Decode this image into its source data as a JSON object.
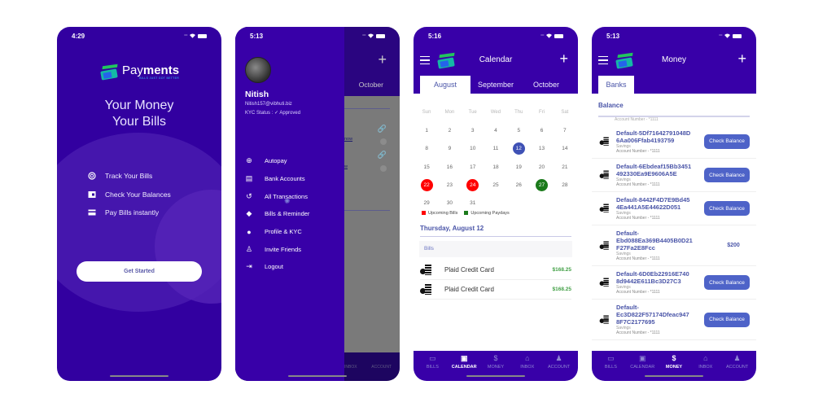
{
  "colors": {
    "brand": "#3800a8",
    "accent": "#4e63c8",
    "bills": "#ff0000",
    "paydays": "#1b7a1b",
    "selected": "#3f51b5",
    "amount": "#43a047"
  },
  "screen1": {
    "time": "4:29",
    "logo": {
      "word_light": "Pay",
      "word_bold": "ments",
      "tagline": "BILLS JUST GOT BETTER"
    },
    "hero": [
      "Your Money",
      "Your Bills"
    ],
    "features": [
      {
        "icon": "track-icon",
        "label": "Track Your Bills"
      },
      {
        "icon": "wallet-icon",
        "label": "Check Your Balances"
      },
      {
        "icon": "card-icon",
        "label": "Pay Bills instantly"
      }
    ],
    "cta": "Get Started"
  },
  "screen2": {
    "time": "5:13",
    "user": {
      "name": "Nitish",
      "email": "Nitish157@vibhuti.biz",
      "kyc": "KYC Status : ✓ Approved"
    },
    "menu": [
      {
        "icon": "add-circle-icon",
        "label": "Autopay"
      },
      {
        "icon": "bank-icon",
        "label": "Bank Accounts"
      },
      {
        "icon": "history-icon",
        "label": "All Transactions"
      },
      {
        "icon": "tag-icon",
        "label": "Bills & Reminder"
      },
      {
        "icon": "person-icon",
        "label": "Profile & KYC"
      },
      {
        "icon": "invite-icon",
        "label": "Invite Friends"
      },
      {
        "icon": "logout-icon",
        "label": "Logout"
      }
    ],
    "background": {
      "tab": "October",
      "link1": "now",
      "link2": "w",
      "tabbar": [
        "INBOX",
        "ACCOUNT"
      ]
    }
  },
  "screen3": {
    "time": "5:16",
    "title": "Calendar",
    "tabs": [
      "August",
      "September",
      "October"
    ],
    "active_tab": "August",
    "weekdays": [
      "Sun",
      "Mon",
      "Tue",
      "Wed",
      "Thu",
      "Fri",
      "Sat"
    ],
    "weeks": [
      [
        "1",
        "2",
        "3",
        "4",
        "5",
        "6",
        "7"
      ],
      [
        "8",
        "9",
        "10",
        "11",
        "12",
        "13",
        "14"
      ],
      [
        "15",
        "16",
        "17",
        "18",
        "19",
        "20",
        "21"
      ],
      [
        "22",
        "23",
        "24",
        "25",
        "26",
        "27",
        "28"
      ],
      [
        "29",
        "30",
        "31",
        "",
        "",
        "",
        ""
      ]
    ],
    "marked": {
      "12": "selected",
      "22": "bill",
      "24": "bill",
      "27": "payday"
    },
    "legend": [
      "Upcoming Bills",
      "Upcoming Paydays"
    ],
    "date_heading": "Thursday, August 12",
    "section": "Bills",
    "bills": [
      {
        "name": "Plaid Credit Card",
        "amount": "$168.25"
      },
      {
        "name": "Plaid Credit Card",
        "amount": "$168.25"
      }
    ]
  },
  "screen4": {
    "time": "5:13",
    "title": "Money",
    "tabs": [
      "Banks"
    ],
    "balance_label": "Balance",
    "ghost_text": "Account Number - *1111",
    "accounts": [
      {
        "name": [
          "Default-5Df71642791048D",
          "6Aa006Ffab4193759"
        ],
        "type": "Savings",
        "number": "Account Number - *1111",
        "action": "Check Balance"
      },
      {
        "name": [
          "Default-6Ebdeaf15Bb3451",
          "492330Ea9E9606A5E"
        ],
        "type": "Savings",
        "number": "Account Number - *1111",
        "action": "Check Balance"
      },
      {
        "name": [
          "Default-8442F4D7E9Bd45",
          "4Ea441A5E44622D051"
        ],
        "type": "Savings",
        "number": "Account Number - *1111",
        "action": "Check Balance"
      },
      {
        "name": [
          "Default-",
          "Ebd088Ea369B4405B0D21",
          "F27Fa2E8Fcc"
        ],
        "type": "Savings",
        "number": "Account Number - *1111",
        "balance": "$200"
      },
      {
        "name": [
          "Default-6D0Eb22916E740",
          "8d9442E611Bc3D27C3"
        ],
        "type": "Savings",
        "number": "Account Number - *1111",
        "action": "Check Balance"
      },
      {
        "name": [
          "Default-",
          "Ec3D822F57174Dfeac947",
          "8F7C2177695"
        ],
        "type": "Savings",
        "number": "Account Number - *1111",
        "action": "Check Balance"
      }
    ]
  },
  "tabbar": [
    {
      "icon": "bills-icon",
      "label": "BILLS"
    },
    {
      "icon": "calendar-icon",
      "label": "CALENDAR"
    },
    {
      "icon": "dollar-icon",
      "label": "MONEY"
    },
    {
      "icon": "inbox-icon",
      "label": "INBOX"
    },
    {
      "icon": "account-icon",
      "label": "ACCOUNT"
    }
  ]
}
